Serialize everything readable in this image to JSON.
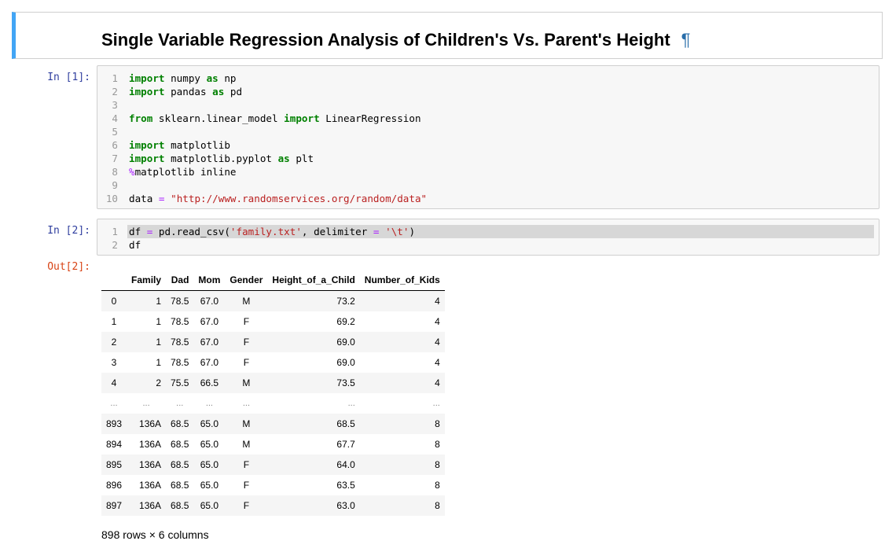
{
  "markdown": {
    "title": "Single Variable Regression Analysis of Children's Vs. Parent's Height",
    "anchor": "¶"
  },
  "cell1": {
    "prompt": "In [1]:",
    "lines": [
      {
        "n": "1",
        "tokens": [
          {
            "t": "import",
            "c": "kw"
          },
          {
            "t": " numpy ",
            "c": "pl"
          },
          {
            "t": "as",
            "c": "kw"
          },
          {
            "t": " np",
            "c": "pl"
          }
        ]
      },
      {
        "n": "2",
        "tokens": [
          {
            "t": "import",
            "c": "kw"
          },
          {
            "t": " pandas ",
            "c": "pl"
          },
          {
            "t": "as",
            "c": "kw"
          },
          {
            "t": " pd",
            "c": "pl"
          }
        ]
      },
      {
        "n": "3",
        "tokens": []
      },
      {
        "n": "4",
        "tokens": [
          {
            "t": "from",
            "c": "kw"
          },
          {
            "t": " sklearn.linear_model ",
            "c": "pl"
          },
          {
            "t": "import",
            "c": "kw"
          },
          {
            "t": " LinearRegression",
            "c": "pl"
          }
        ]
      },
      {
        "n": "5",
        "tokens": []
      },
      {
        "n": "6",
        "tokens": [
          {
            "t": "import",
            "c": "kw"
          },
          {
            "t": " matplotlib",
            "c": "pl"
          }
        ]
      },
      {
        "n": "7",
        "tokens": [
          {
            "t": "import",
            "c": "kw"
          },
          {
            "t": " matplotlib.pyplot ",
            "c": "pl"
          },
          {
            "t": "as",
            "c": "kw"
          },
          {
            "t": " plt",
            "c": "pl"
          }
        ]
      },
      {
        "n": "8",
        "tokens": [
          {
            "t": "%",
            "c": "op"
          },
          {
            "t": "matplotlib inline",
            "c": "pl"
          }
        ]
      },
      {
        "n": "9",
        "tokens": []
      },
      {
        "n": "10",
        "tokens": [
          {
            "t": "data ",
            "c": "pl"
          },
          {
            "t": "=",
            "c": "op"
          },
          {
            "t": " ",
            "c": "pl"
          },
          {
            "t": "\"http://www.randomservices.org/random/data\"",
            "c": "str"
          }
        ]
      }
    ]
  },
  "cell2": {
    "prompt": "In [2]:",
    "lines": [
      {
        "n": "1",
        "highlight": true,
        "tokens": [
          {
            "t": "df ",
            "c": "pl"
          },
          {
            "t": "=",
            "c": "op"
          },
          {
            "t": " pd.read_csv(",
            "c": "pl"
          },
          {
            "t": "'family.txt'",
            "c": "str"
          },
          {
            "t": ", delimiter ",
            "c": "pl"
          },
          {
            "t": "=",
            "c": "op"
          },
          {
            "t": " ",
            "c": "pl"
          },
          {
            "t": "'\\t'",
            "c": "str"
          },
          {
            "t": ")",
            "c": "pl"
          }
        ]
      },
      {
        "n": "2",
        "tokens": [
          {
            "t": "df",
            "c": "pl"
          }
        ]
      }
    ]
  },
  "output2": {
    "prompt": "Out[2]:",
    "columns": [
      "",
      "Family",
      "Dad",
      "Mom",
      "Gender",
      "Height_of_a_Child",
      "Number_of_Kids"
    ],
    "rows": [
      [
        "0",
        "1",
        "78.5",
        "67.0",
        "M",
        "73.2",
        "4"
      ],
      [
        "1",
        "1",
        "78.5",
        "67.0",
        "F",
        "69.2",
        "4"
      ],
      [
        "2",
        "1",
        "78.5",
        "67.0",
        "F",
        "69.0",
        "4"
      ],
      [
        "3",
        "1",
        "78.5",
        "67.0",
        "F",
        "69.0",
        "4"
      ],
      [
        "4",
        "2",
        "75.5",
        "66.5",
        "M",
        "73.5",
        "4"
      ],
      [
        "...",
        "...",
        "...",
        "...",
        "...",
        "...",
        "..."
      ],
      [
        "893",
        "136A",
        "68.5",
        "65.0",
        "M",
        "68.5",
        "8"
      ],
      [
        "894",
        "136A",
        "68.5",
        "65.0",
        "M",
        "67.7",
        "8"
      ],
      [
        "895",
        "136A",
        "68.5",
        "65.0",
        "F",
        "64.0",
        "8"
      ],
      [
        "896",
        "136A",
        "68.5",
        "65.0",
        "F",
        "63.5",
        "8"
      ],
      [
        "897",
        "136A",
        "68.5",
        "65.0",
        "F",
        "63.0",
        "8"
      ]
    ],
    "shape_text": "898 rows × 6 columns"
  },
  "colors": {
    "in_prompt": "#303f9f",
    "out_prompt": "#d84315",
    "selected_cell_border": "#42a5f5",
    "keyword": "#008000",
    "string": "#ba2121",
    "operator": "#aa22ff"
  }
}
